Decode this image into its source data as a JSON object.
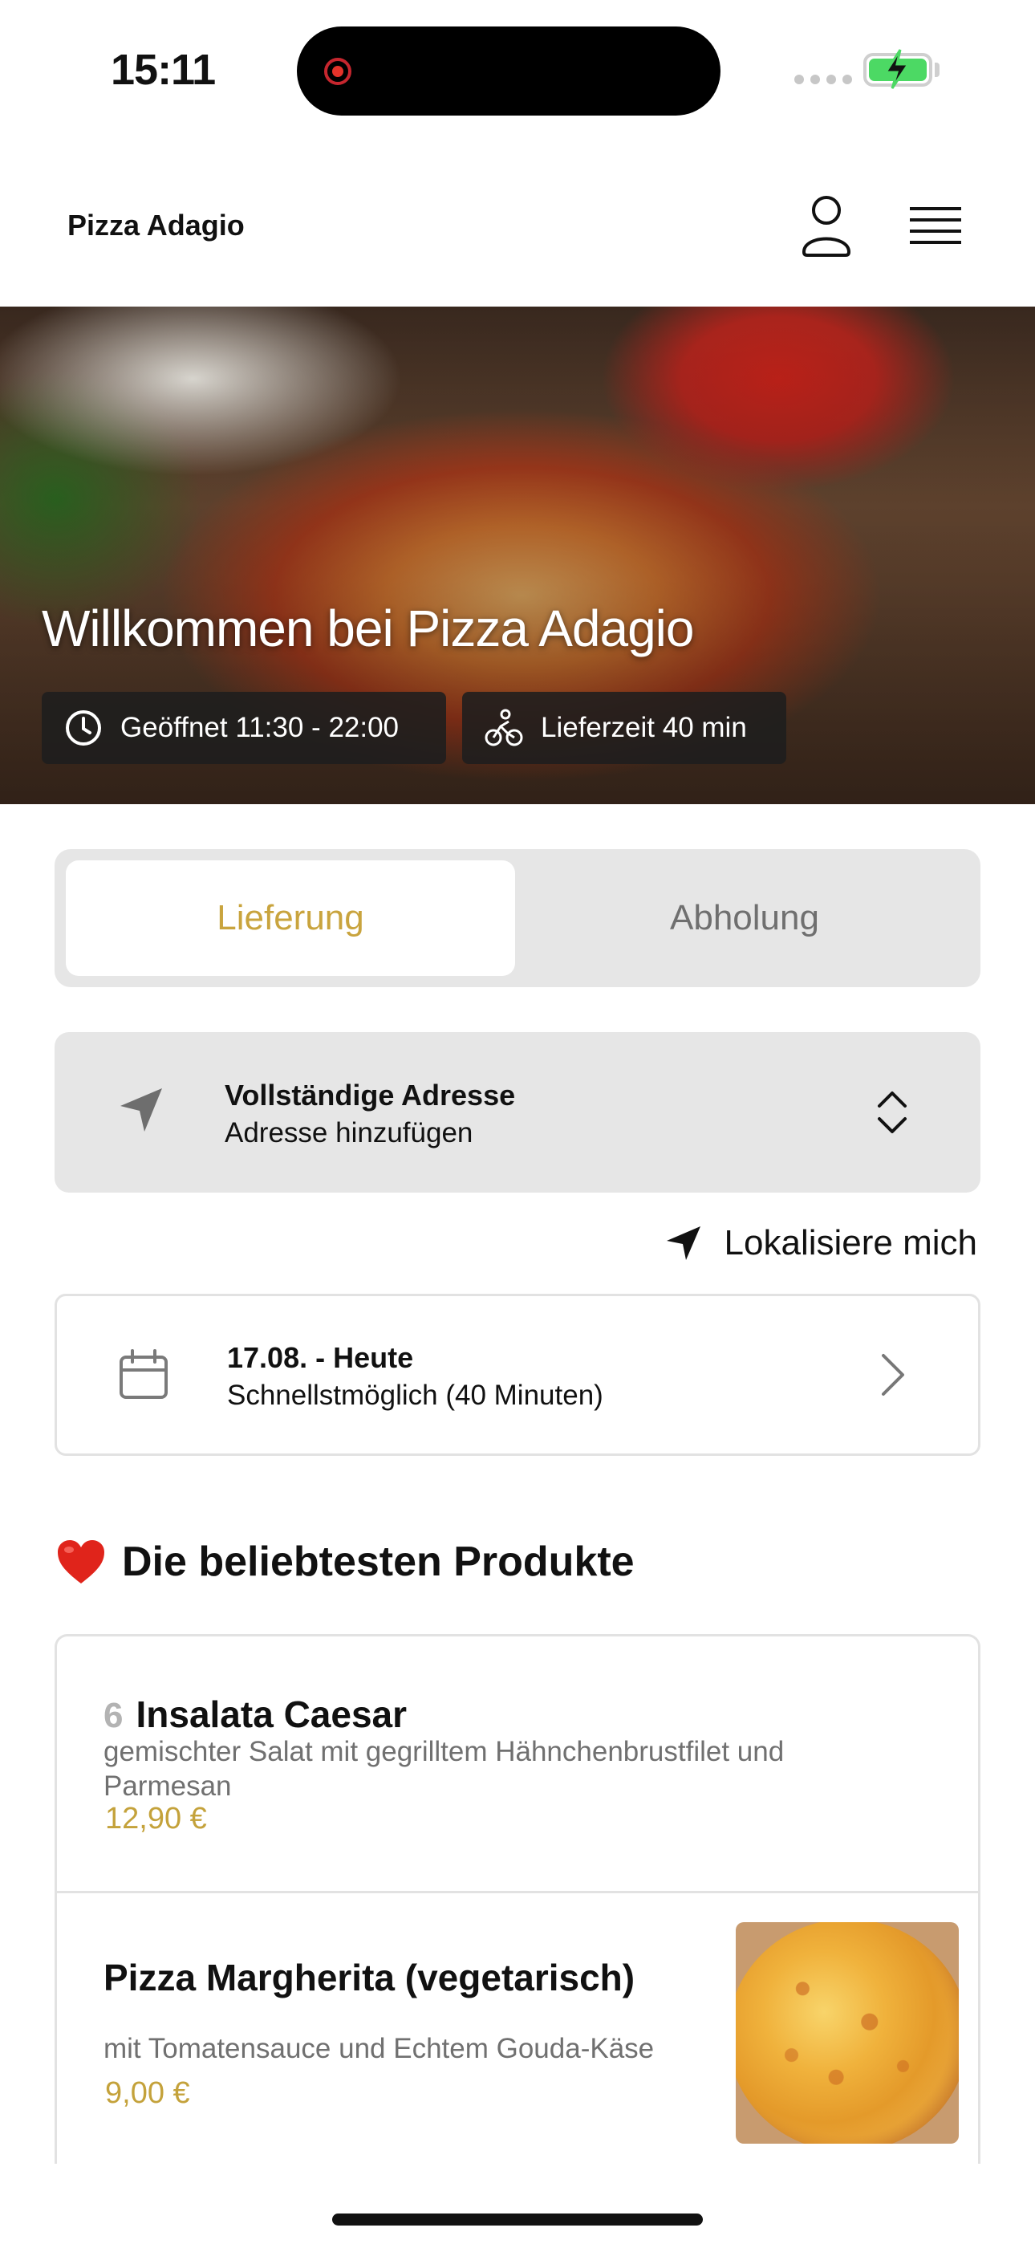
{
  "status_bar": {
    "time": "15:11"
  },
  "header": {
    "brand": "Pizza Adagio"
  },
  "hero": {
    "title": "Willkommen bei Pizza Adagio",
    "open_hours": "Geöffnet 11:30 - 22:00",
    "delivery_time": "Lieferzeit 40 min"
  },
  "mode_toggle": {
    "delivery": "Lieferung",
    "pickup": "Abholung",
    "selected": "Lieferung"
  },
  "address": {
    "title": "Vollständige Adresse",
    "subtitle": "Adresse hinzufügen"
  },
  "locate_label": "Lokalisiere mich",
  "schedule": {
    "date": "17.08. - Heute",
    "time": "Schnellstmöglich (40 Minuten)"
  },
  "popular": {
    "title": "Die beliebtesten Produkte",
    "products": [
      {
        "number": "6",
        "name": "Insalata Caesar",
        "description": "gemischter Salat mit gegrilltem Hähnchenbrustfilet und Parmesan",
        "price": "12,90 €"
      },
      {
        "name": "Pizza Margherita (vegetarisch)",
        "description": "mit Tomatensauce und Echtem Gouda-Käse",
        "price": "9,00 €"
      }
    ]
  },
  "colors": {
    "accent": "#c9a43e",
    "segment_bg": "#e6e6e6",
    "chip_bg": "#1e1e1e"
  },
  "icons": [
    "record-icon",
    "battery-charging-icon",
    "user-icon",
    "menu-icon",
    "clock-icon",
    "bicycle-icon",
    "navigation-arrow-icon",
    "up-down-chevron-icon",
    "calendar-icon",
    "chevron-right-icon",
    "heart-icon"
  ]
}
